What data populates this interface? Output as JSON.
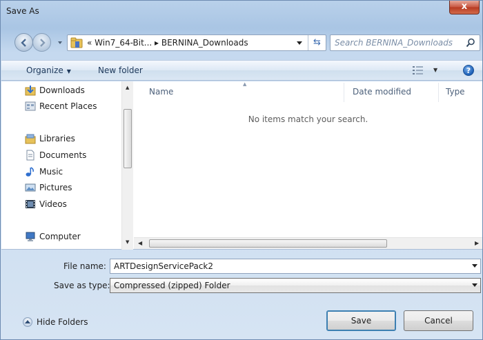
{
  "window": {
    "title": "Save As",
    "close_label": "x"
  },
  "address": {
    "path": "« Win7_64-Bit... ▸ BERNINA_Downloads",
    "refresh_glyph": "⇆"
  },
  "search": {
    "placeholder": "Search BERNINA_Downloads"
  },
  "toolbar": {
    "organize_label": "Organize",
    "new_folder_label": "New folder",
    "help_label": "?"
  },
  "nav_pane": {
    "items": [
      {
        "label": "Downloads",
        "icon": "downloads-icon"
      },
      {
        "label": "Recent Places",
        "icon": "recent-places-icon"
      },
      {
        "label": "Libraries",
        "icon": "libraries-icon"
      },
      {
        "label": "Documents",
        "icon": "documents-icon"
      },
      {
        "label": "Music",
        "icon": "music-icon"
      },
      {
        "label": "Pictures",
        "icon": "pictures-icon"
      },
      {
        "label": "Videos",
        "icon": "videos-icon"
      },
      {
        "label": "Computer",
        "icon": "computer-icon"
      }
    ]
  },
  "file_list": {
    "columns": [
      "Name",
      "Date modified",
      "Type"
    ],
    "empty_message": "No items match your search."
  },
  "form": {
    "file_name_label": "File name:",
    "file_name_value": "ARTDesignServicePack2",
    "save_type_label": "Save as type:",
    "save_type_value": "Compressed (zipped) Folder"
  },
  "footer": {
    "hide_folders_label": "Hide Folders",
    "save_label": "Save",
    "cancel_label": "Cancel"
  },
  "colors": {
    "accent": "#3c7fb1",
    "window_frame": "#b9d1ea",
    "toolbar_text": "#1e395b"
  }
}
